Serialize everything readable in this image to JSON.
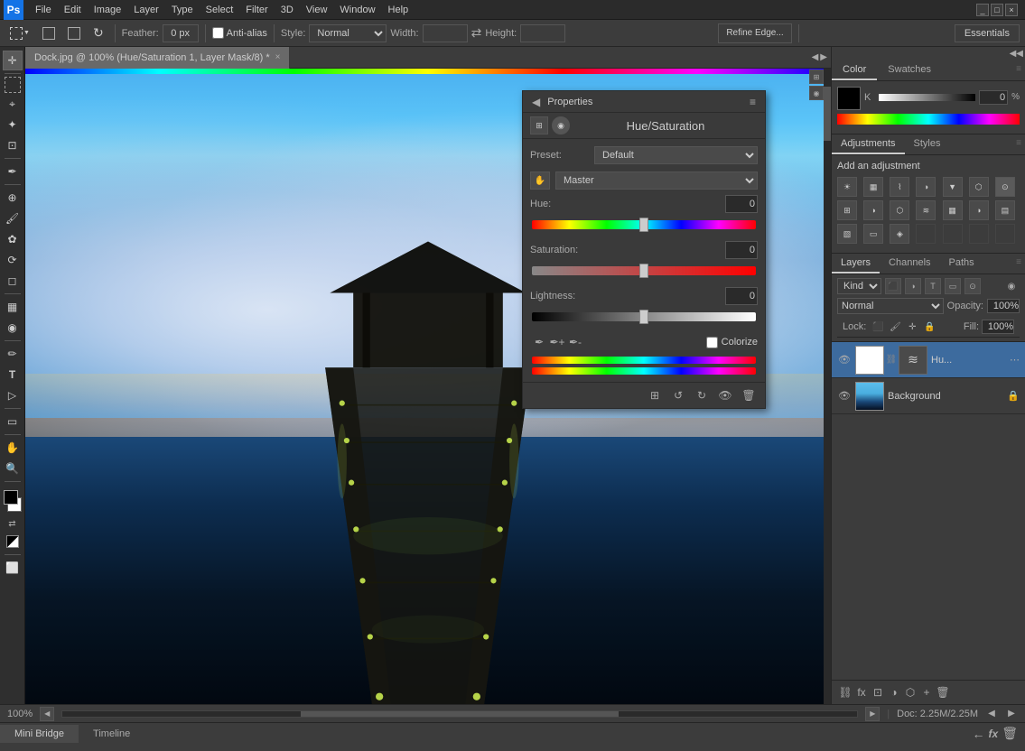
{
  "app": {
    "title": "Adobe Photoshop",
    "ps_label": "Ps"
  },
  "menu": {
    "items": [
      "File",
      "Edit",
      "Image",
      "Layer",
      "Type",
      "Select",
      "Filter",
      "3D",
      "View",
      "Window",
      "Help"
    ]
  },
  "toolbar": {
    "feather_label": "Feather:",
    "feather_value": "0 px",
    "antialias_label": "Anti-alias",
    "style_label": "Style:",
    "style_value": "Normal",
    "width_label": "Width:",
    "height_label": "Height:",
    "refine_edge_label": "Refine Edge...",
    "essentials_label": "Essentials"
  },
  "tab": {
    "title": "Dock.jpg @ 100% (Hue/Saturation 1, Layer Mask/8) *",
    "close": "×"
  },
  "properties_panel": {
    "title": "Properties",
    "panel_title": "Hue/Saturation",
    "preset_label": "Preset:",
    "preset_value": "Default",
    "channel_label": "Master",
    "hue_label": "Hue:",
    "hue_value": "0",
    "saturation_label": "Saturation:",
    "saturation_value": "0",
    "lightness_label": "Lightness:",
    "lightness_value": "0",
    "colorize_label": "Colorize",
    "hue_thumb_pct": 50,
    "sat_thumb_pct": 50,
    "light_thumb_pct": 50
  },
  "color_panel": {
    "tab_color": "Color",
    "tab_swatches": "Swatches",
    "channel_k": "K",
    "channel_k_value": "0",
    "channel_pct": "%"
  },
  "adjustments_panel": {
    "tab_adjustments": "Adjustments",
    "tab_styles": "Styles",
    "title": "Add an adjustment"
  },
  "layers_panel": {
    "tab_layers": "Layers",
    "tab_channels": "Channels",
    "tab_paths": "Paths",
    "kind_label": "Kind",
    "blend_mode": "Normal",
    "opacity_label": "Opacity:",
    "opacity_value": "100%",
    "lock_label": "Lock:",
    "fill_label": "Fill:",
    "fill_value": "100%",
    "layers": [
      {
        "name": "Hu...",
        "type": "adjustment",
        "visible": true
      },
      {
        "name": "Background",
        "type": "image",
        "visible": true,
        "locked": true
      }
    ]
  },
  "status_bar": {
    "zoom": "100%",
    "doc_info": "Doc: 2.25M/2.25M"
  },
  "bottom_panel": {
    "tab_mini_bridge": "Mini Bridge",
    "tab_timeline": "Timeline"
  },
  "tools": {
    "items": [
      "▭",
      "◻",
      "⊙",
      "✏",
      "🖌",
      "✿",
      "⬡",
      "⚗",
      "✂",
      "⌨",
      "➤",
      "🔍",
      "☁"
    ],
    "labels": [
      "marquee",
      "lasso",
      "crop",
      "brush",
      "clone",
      "heal",
      "shape",
      "text",
      "path",
      "hand",
      "zoom",
      "eyedropper",
      "gradient"
    ]
  }
}
